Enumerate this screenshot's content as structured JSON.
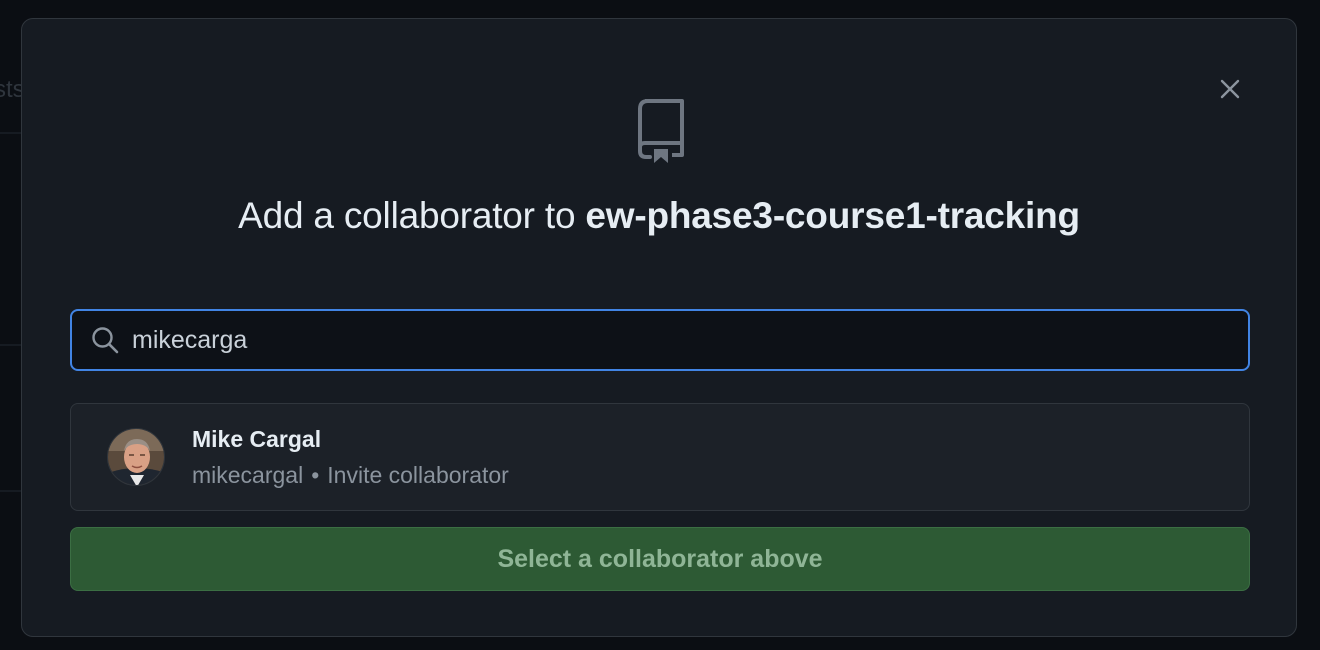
{
  "dialog": {
    "title_prefix": "Add a collaborator to ",
    "repo_name": "ew-phase3-course1-tracking",
    "icons": {
      "close": "close-icon",
      "repo": "repo-icon",
      "search": "search-icon"
    }
  },
  "search": {
    "value": "mikecarga",
    "placeholder": ""
  },
  "results": [
    {
      "name": "Mike Cargal",
      "username": "mikecargal",
      "separator": "•",
      "action": "Invite collaborator"
    }
  ],
  "submit": {
    "label": "Select a collaborator above",
    "disabled": true
  },
  "background": {
    "fragment_text": "sts"
  },
  "colors": {
    "focus_border": "#4184e4",
    "button_bg": "#2d5a34",
    "dialog_bg": "#161b22"
  }
}
